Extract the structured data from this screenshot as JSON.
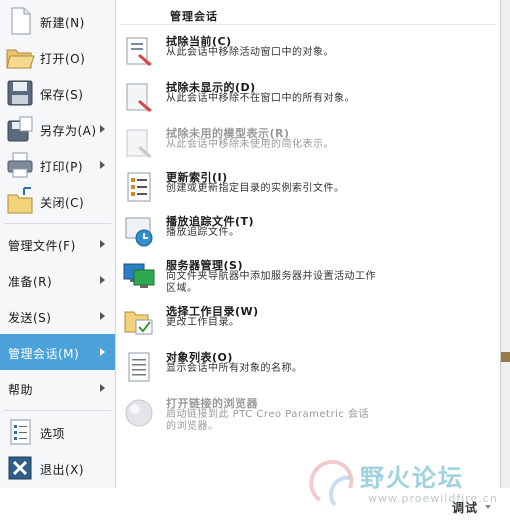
{
  "left_menu": {
    "new": "新建(N)",
    "open": "打开(O)",
    "save": "保存(S)",
    "save_as": "另存为(A)",
    "print": "打印(P)",
    "close": "关闭(C)",
    "manage_file": "管理文件(F)",
    "prepare": "准备(R)",
    "send": "发送(S)",
    "manage_session": "管理会话(M)",
    "help": "帮助",
    "options": "选项",
    "exit": "退出(X)"
  },
  "submenu": {
    "header": "管理会话",
    "items": [
      {
        "title": "拭除当前(C)",
        "desc": "从此会话中移除活动窗口中的对象。",
        "icon": "erase-current-icon",
        "enabled": true
      },
      {
        "title": "拭除未显示的(D)",
        "desc": "从此会话中移除不在窗口中的所有对象。",
        "icon": "erase-not-displayed-icon",
        "enabled": true
      },
      {
        "title": "拭除未用的模型表示(R)",
        "desc": "从此会话中移除未使用的简化表示。",
        "icon": "erase-unused-reps-icon",
        "enabled": false
      },
      {
        "title": "更新索引(I)",
        "desc": "创建或更新指定目录的实例索引文件。",
        "icon": "update-index-icon",
        "enabled": true
      },
      {
        "title": "播放追踪文件(T)",
        "desc": "播放追踪文件。",
        "icon": "play-trail-file-icon",
        "enabled": true
      },
      {
        "title": "服务器管理(S)",
        "desc": "向文件夹导航器中添加服务器并设置活动工作区域。",
        "icon": "server-management-icon",
        "enabled": true
      },
      {
        "title": "选择工作目录(W)",
        "desc": "更改工作目录。",
        "icon": "select-working-directory-icon",
        "enabled": true
      },
      {
        "title": "对象列表(O)",
        "desc": "显示会话中所有对象的名称。",
        "icon": "object-list-icon",
        "enabled": true
      },
      {
        "title": "打开链接的浏览器",
        "desc": "启动链接到此 PTC Creo Parametric 会话的浏览器。",
        "icon": "open-linked-browser-icon",
        "enabled": false
      }
    ]
  },
  "status_bar": {
    "debug_label": "调试"
  },
  "watermark": {
    "text": "野火论坛",
    "url": "www.proewildfire.cn"
  },
  "colors": {
    "selected_bg": "#4ba2d8",
    "panel_border": "#c6cbd3",
    "left_bg": "#f6f7f9"
  }
}
